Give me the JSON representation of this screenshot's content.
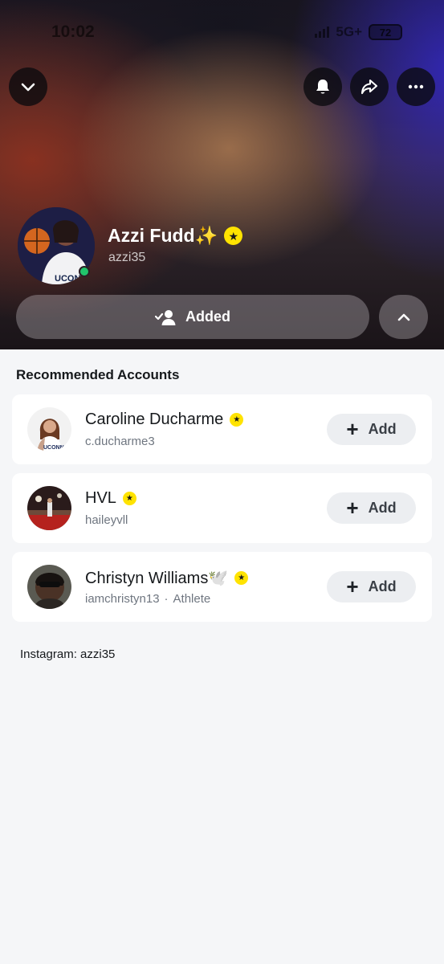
{
  "status_bar": {
    "time": "10:02",
    "network": "5G+",
    "battery": "72"
  },
  "profile": {
    "name": "Azzi Fudd✨",
    "handle": "azzi35",
    "friend_status_label": "Added"
  },
  "section": {
    "title": "Recommended Accounts"
  },
  "recommended": [
    {
      "name": "Caroline Ducharme",
      "username": "c.ducharme3",
      "category": "",
      "add_label": "Add"
    },
    {
      "name": "HVL",
      "username": "haileyvll",
      "category": "",
      "add_label": "Add"
    },
    {
      "name": "Christyn Williams🕊️",
      "username": "iamchristyn13",
      "category": "Athlete",
      "add_label": "Add"
    }
  ],
  "footer": {
    "text": "Instagram: azzi35"
  },
  "colors": {
    "verified": "#ffe300",
    "online": "#21c46b",
    "add_button_bg": "#eceef1"
  }
}
